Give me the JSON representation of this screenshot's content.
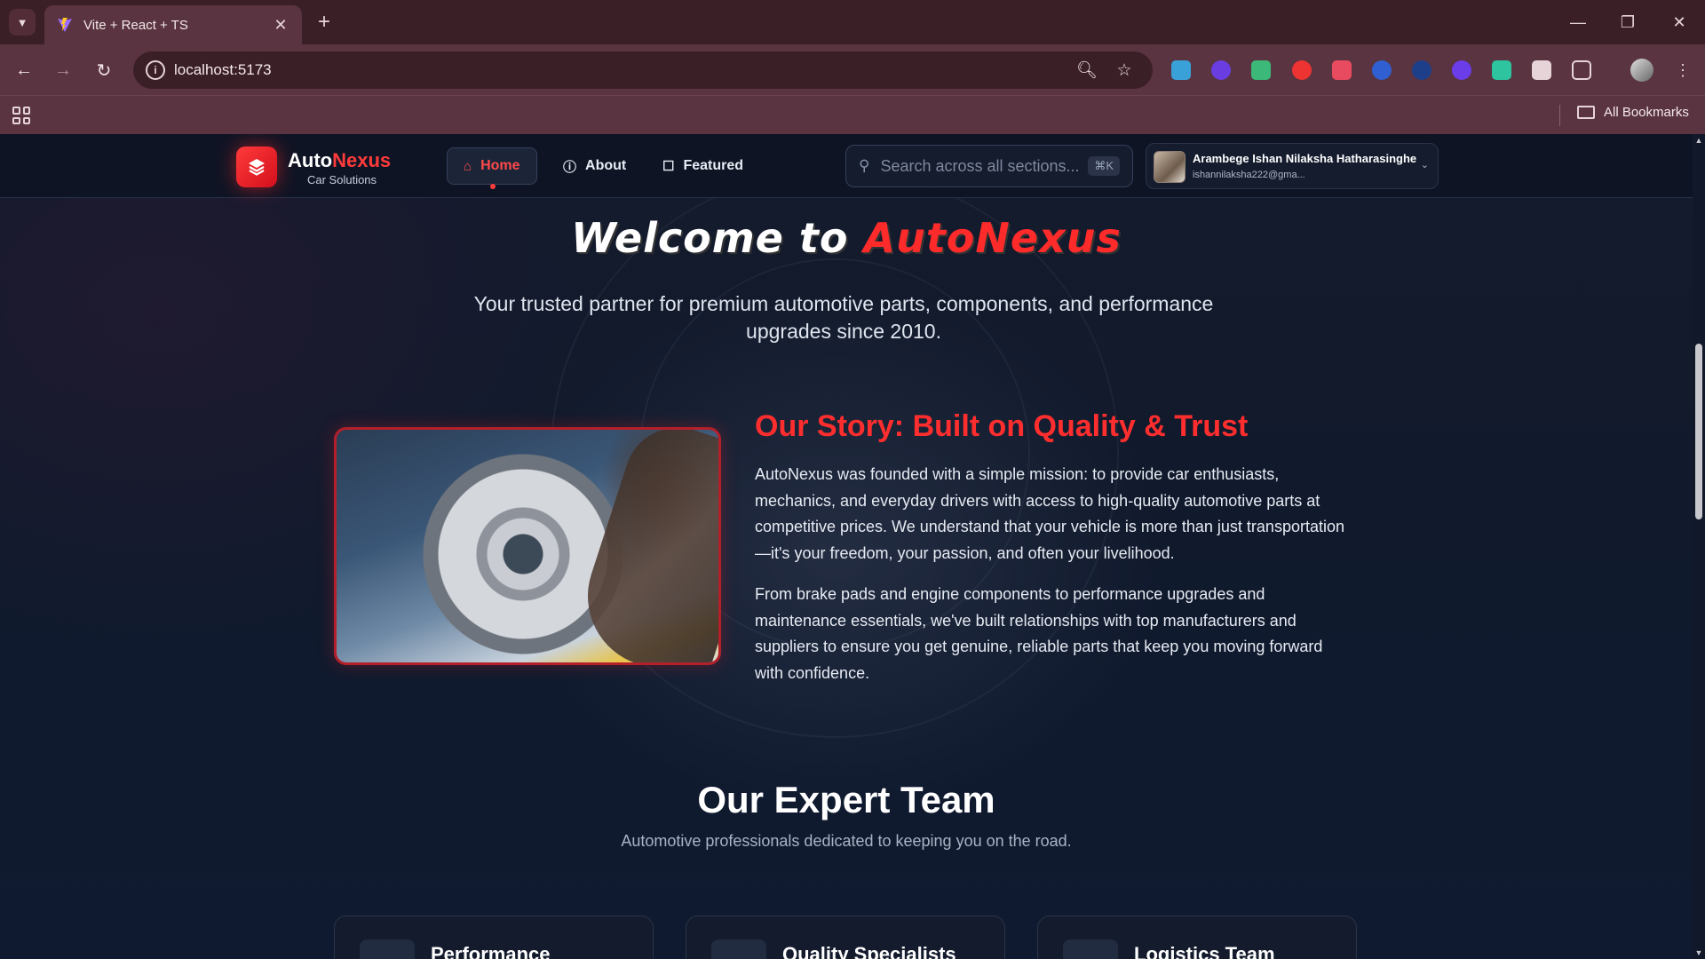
{
  "browser": {
    "tab_title": "Vite + React + TS",
    "url": "localhost:5173",
    "bookmarks_label": "All Bookmarks"
  },
  "site": {
    "logo_main": "Auto",
    "logo_accent": "Nexus",
    "logo_sub": "Car Solutions",
    "nav": [
      {
        "label": "Home",
        "icon": "home-icon",
        "active": true
      },
      {
        "label": "About",
        "icon": "info-icon"
      },
      {
        "label": "Featured",
        "icon": "featured-icon"
      }
    ],
    "search_placeholder": "Search across all sections...",
    "search_shortcut": "⌘K",
    "user_name": "Arambege Ishan Nilaksha Hatharasinghe",
    "user_email": "ishannilaksha222@gma..."
  },
  "hero": {
    "title_main": "Welcome to ",
    "title_accent": "AutoNexus",
    "subtitle": "Your trusted partner for premium automotive parts, components, and performance upgrades since 2010."
  },
  "story": {
    "heading": "Our Story: Built on Quality & Trust",
    "paragraphs": [
      "AutoNexus was founded with a simple mission: to provide car enthusiasts, mechanics, and everyday drivers with access to high-quality automotive parts at competitive prices. We understand that your vehicle is more than just transportation—it's your freedom, your passion, and often your livelihood.",
      "From brake pads and engine components to performance upgrades and maintenance essentials, we've built relationships with top manufacturers and suppliers to ensure you get genuine, reliable parts that keep you moving forward with confidence."
    ]
  },
  "team": {
    "heading": "Our Expert Team",
    "subtitle": "Automotive professionals dedicated to keeping you on the road.",
    "cards": [
      {
        "title": "Performance"
      },
      {
        "title": "Quality Specialists"
      },
      {
        "title": "Logistics Team"
      }
    ]
  },
  "colors": {
    "accent": "#ff2e2e",
    "browser_frame": "#5a3440",
    "page_bg": "#111a2c"
  }
}
